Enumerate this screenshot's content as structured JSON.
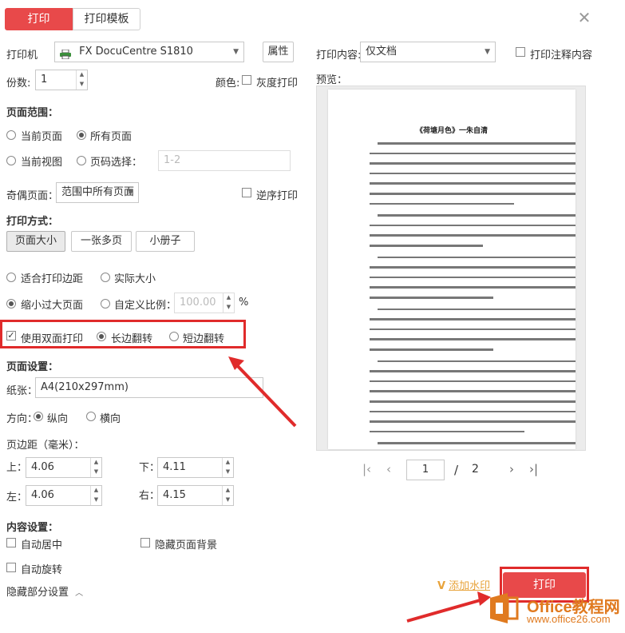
{
  "tabs": {
    "print": "打印",
    "template": "打印模板"
  },
  "printer": {
    "label": "打印机",
    "name": "FX DocuCentre S1810",
    "properties": "属性",
    "copies_label": "份数:",
    "copies": "1",
    "color_label": "颜色:",
    "grayscale": "灰度打印"
  },
  "range": {
    "title": "页面范围：",
    "current_page": "当前页面",
    "all_pages": "所有页面",
    "current_view": "当前视图",
    "page_select": "页码选择：",
    "page_select_placeholder": "1-2",
    "odd_even_label": "奇偶页面：",
    "odd_even_value": "范围中所有页面",
    "reverse": "逆序打印"
  },
  "method": {
    "title": "打印方式：",
    "actual": "页面大小",
    "multi": "一张多页",
    "booklet": "小册子",
    "fit_margin": "适合打印边距",
    "actual_size": "实际大小",
    "shrink": "缩小过大页面",
    "custom_scale": "自定义比例：",
    "scale_value": "100.00",
    "percent": "%"
  },
  "duplex": {
    "enable": "使用双面打印",
    "long_edge": "长边翻转",
    "short_edge": "短边翻转"
  },
  "page_setup": {
    "title": "页面设置：",
    "paper_label": "纸张：",
    "paper_value": "A4(210x297mm)",
    "orientation_label": "方向：",
    "portrait": "纵向",
    "landscape": "横向",
    "margin_title": "页边距（毫米）：",
    "top_label": "上：",
    "top": "4.06",
    "bottom_label": "下：",
    "bottom": "4.11",
    "left_label": "左：",
    "left": "4.06",
    "right_label": "右：",
    "right": "4.15"
  },
  "content": {
    "title": "内容设置：",
    "center": "自动居中",
    "hide_bg": "隐藏页面背景",
    "rotate": "自动旋转",
    "hide_partial": "隐藏部分设置"
  },
  "preview": {
    "content_label": "打印内容:",
    "content_value": "仅文档",
    "annotations": "打印注释内容",
    "preview_label": "预览：",
    "doc_title": "《荷塘月色》一朱自清",
    "current_page": "1",
    "separator": "/",
    "total_pages": "2"
  },
  "actions": {
    "add_watermark": "添加水印",
    "print": "打印"
  },
  "watermark": {
    "brand": "Office教程网",
    "url": "www.office26.com"
  },
  "colors": {
    "accent": "#e8494a",
    "annotation_red": "#e02b2b",
    "brand_orange": "#e07a1f"
  }
}
